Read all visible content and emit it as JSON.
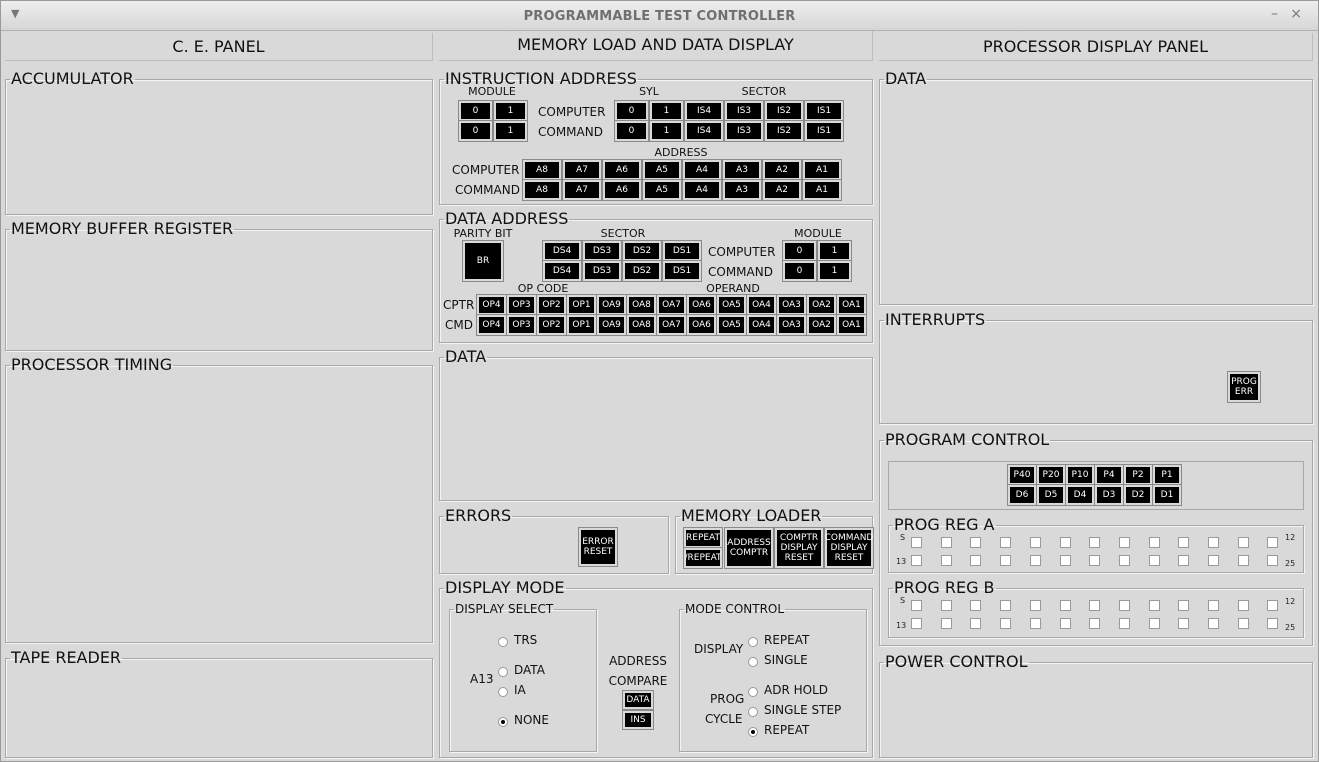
{
  "window": {
    "title": "PROGRAMMABLE TEST CONTROLLER",
    "menu_icon": "down-triangle-icon",
    "minimize_label": "–",
    "close_label": "×"
  },
  "ce_panel": {
    "header": "C. E. PANEL",
    "sections": {
      "accumulator": "ACCUMULATOR",
      "mbr": "MEMORY BUFFER REGISTER",
      "processor_timing": "PROCESSOR TIMING",
      "tape_reader": "TAPE READER"
    }
  },
  "memory": {
    "header": "MEMORY LOAD AND DATA DISPLAY",
    "instruction_address": {
      "title": "INSTRUCTION ADDRESS",
      "module_label": "MODULE",
      "syl_label": "SYL",
      "sector_label": "SECTOR",
      "address_label": "ADDRESS",
      "computer_label": "COMPUTER",
      "command_label": "COMMAND",
      "module_buttons": [
        "0",
        "1"
      ],
      "syl_buttons": [
        "0",
        "1"
      ],
      "sector_buttons": [
        "IS4",
        "IS3",
        "IS2",
        "IS1"
      ],
      "address_buttons": [
        "A8",
        "A7",
        "A6",
        "A5",
        "A4",
        "A3",
        "A2",
        "A1"
      ]
    },
    "data_address": {
      "title": "DATA ADDRESS",
      "parity_label": "PARITY BIT",
      "parity_button": "BR",
      "sector_label": "SECTOR",
      "module_label": "MODULE",
      "computer_label": "COMPUTER",
      "command_label": "COMMAND",
      "sector_buttons": [
        "DS4",
        "DS3",
        "DS2",
        "DS1"
      ],
      "module_buttons": [
        "0",
        "1"
      ],
      "opcode_label": "OP CODE",
      "operand_label": "OPERAND",
      "cptr_label": "CPTR",
      "cmd_label": "CMD",
      "op_buttons": [
        "OP4",
        "OP3",
        "OP2",
        "OP1",
        "OA9",
        "OA8",
        "OA7",
        "OA6",
        "OA5",
        "OA4",
        "OA3",
        "OA2",
        "OA1"
      ]
    },
    "data_title": "DATA",
    "errors": {
      "title": "ERRORS",
      "reset_button": "ERROR\nRESET"
    },
    "memory_loader": {
      "title": "MEMORY LOADER",
      "repeat": "REPEAT",
      "not_repeat": "/REPEAT",
      "address_comptr": "ADDRESS\nCOMPTR",
      "comptr_display_reset": "COMPTR\nDISPLAY\nRESET",
      "command_display_reset": "COMMAND\nDISPLAY\nRESET"
    },
    "display_mode": {
      "title": "DISPLAY MODE",
      "display_select": {
        "title": "DISPLAY SELECT",
        "trs": "TRS",
        "a13": "A13",
        "data": "DATA",
        "ia": "IA",
        "none": "NONE",
        "selected": "NONE"
      },
      "address_compare": {
        "line1": "ADDRESS",
        "line2": "COMPARE",
        "data_button": "DATA",
        "ins_button": "INS"
      },
      "mode_control": {
        "title": "MODE CONTROL",
        "display_label": "DISPLAY",
        "repeat": "REPEAT",
        "single": "SINGLE",
        "prog_label": "PROG",
        "cycle_label": "CYCLE",
        "adr_hold": "ADR HOLD",
        "single_step": "SINGLE STEP",
        "cycle_repeat": "REPEAT",
        "selected_cycle": "REPEAT"
      }
    }
  },
  "processor": {
    "header": "PROCESSOR DISPLAY PANEL",
    "data_title": "DATA",
    "interrupts": {
      "title": "INTERRUPTS",
      "prog_err": "PROG\nERR"
    },
    "program_control": {
      "title": "PROGRAM CONTROL",
      "p_buttons": [
        "P40",
        "P20",
        "P10",
        "P4",
        "P2",
        "P1"
      ],
      "d_buttons": [
        "D6",
        "D5",
        "D4",
        "D3",
        "D2",
        "D1"
      ],
      "prog_reg_a": {
        "title": "PROG REG A",
        "row1_left": "S",
        "row1_right": "12",
        "row2_left": "13",
        "row2_right": "25"
      },
      "prog_reg_b": {
        "title": "PROG REG B",
        "row1_left": "S",
        "row1_right": "12",
        "row2_left": "13",
        "row2_right": "25"
      }
    },
    "power_control": {
      "title": "POWER CONTROL"
    }
  }
}
